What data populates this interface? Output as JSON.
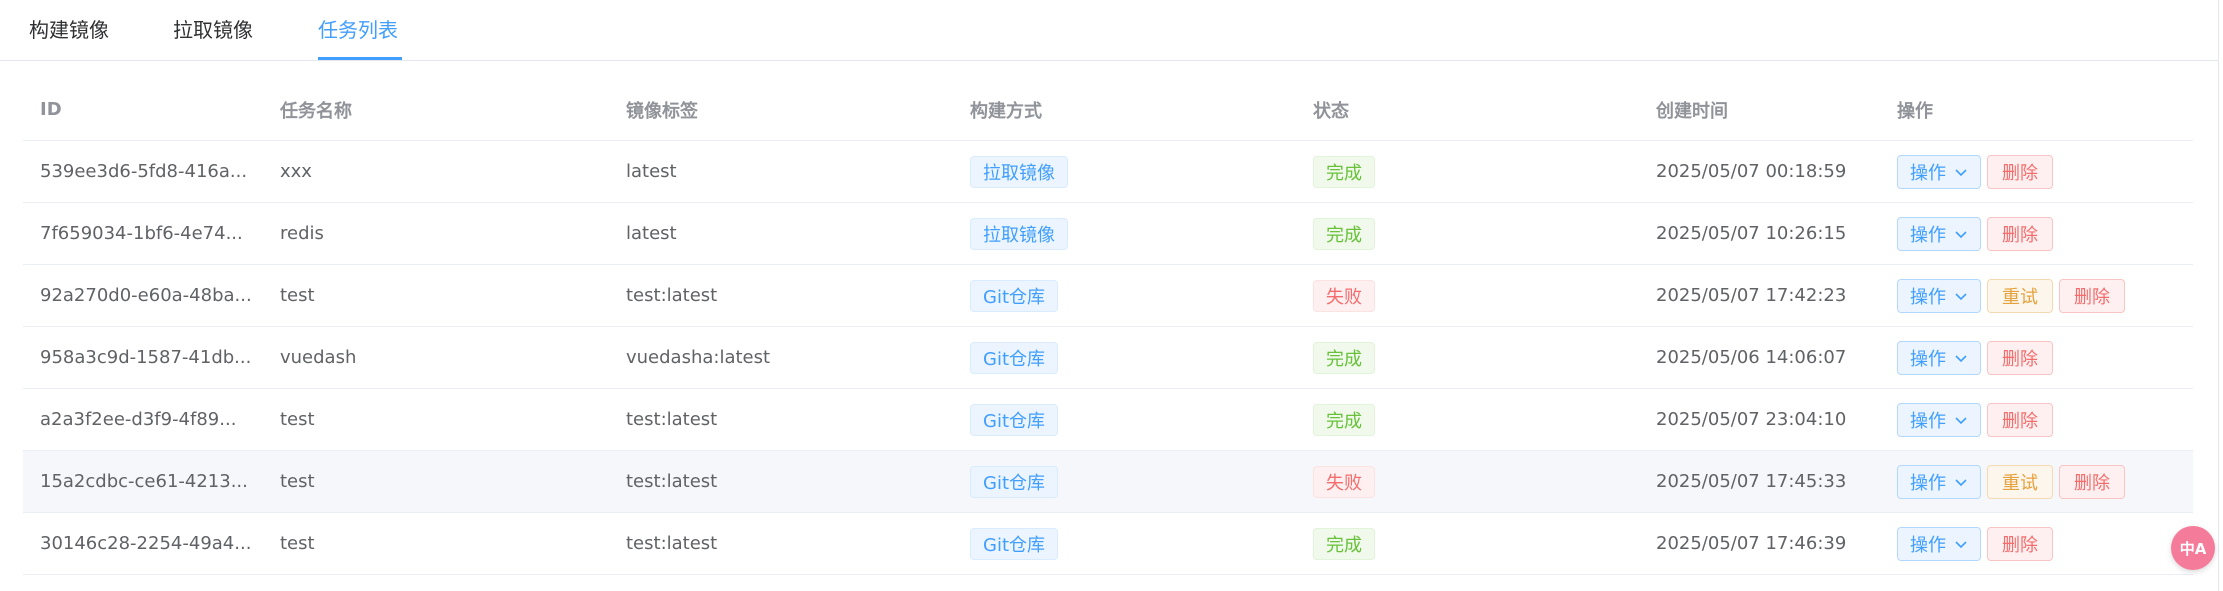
{
  "tabs": [
    {
      "label": "构建镜像",
      "active": false
    },
    {
      "label": "拉取镜像",
      "active": false
    },
    {
      "label": "任务列表",
      "active": true
    }
  ],
  "table": {
    "headers": [
      "ID",
      "任务名称",
      "镜像标签",
      "构建方式",
      "状态",
      "创建时间",
      "操作"
    ],
    "rows": [
      {
        "id": "539ee3d6-5fd8-416a...",
        "name": "xxx",
        "tag": "latest",
        "method": "拉取镜像",
        "status": "完成",
        "status_type": "success",
        "created": "2025/05/07 00:18:59",
        "actions": [
          "操作",
          "删除"
        ]
      },
      {
        "id": "7f659034-1bf6-4e74...",
        "name": "redis",
        "tag": "latest",
        "method": "拉取镜像",
        "status": "完成",
        "status_type": "success",
        "created": "2025/05/07 10:26:15",
        "actions": [
          "操作",
          "删除"
        ]
      },
      {
        "id": "92a270d0-e60a-48ba...",
        "name": "test",
        "tag": "test:latest",
        "method": "Git仓库",
        "status": "失败",
        "status_type": "danger",
        "created": "2025/05/07 17:42:23",
        "actions": [
          "操作",
          "重试",
          "删除"
        ]
      },
      {
        "id": "958a3c9d-1587-41db...",
        "name": "vuedash",
        "tag": "vuedasha:latest",
        "method": "Git仓库",
        "status": "完成",
        "status_type": "success",
        "created": "2025/05/06 14:06:07",
        "actions": [
          "操作",
          "删除"
        ]
      },
      {
        "id": "a2a3f2ee-d3f9-4f89...",
        "name": "test",
        "tag": "test:latest",
        "method": "Git仓库",
        "status": "完成",
        "status_type": "success",
        "created": "2025/05/07 23:04:10",
        "actions": [
          "操作",
          "删除"
        ]
      },
      {
        "id": "15a2cdbc-ce61-4213...",
        "name": "test",
        "tag": "test:latest",
        "method": "Git仓库",
        "status": "失败",
        "status_type": "danger",
        "created": "2025/05/07 17:45:33",
        "actions": [
          "操作",
          "重试",
          "删除"
        ],
        "hovered": true
      },
      {
        "id": "30146c28-2254-49a4...",
        "name": "test",
        "tag": "test:latest",
        "method": "Git仓库",
        "status": "完成",
        "status_type": "success",
        "created": "2025/05/07 17:46:39",
        "actions": [
          "操作",
          "删除"
        ]
      }
    ]
  },
  "floating_button": {
    "icon": "translate-icon",
    "label": "中A"
  },
  "colors": {
    "primary": "#409eff",
    "success": "#67c23a",
    "danger": "#f56c6c",
    "warning": "#e6a23c"
  }
}
